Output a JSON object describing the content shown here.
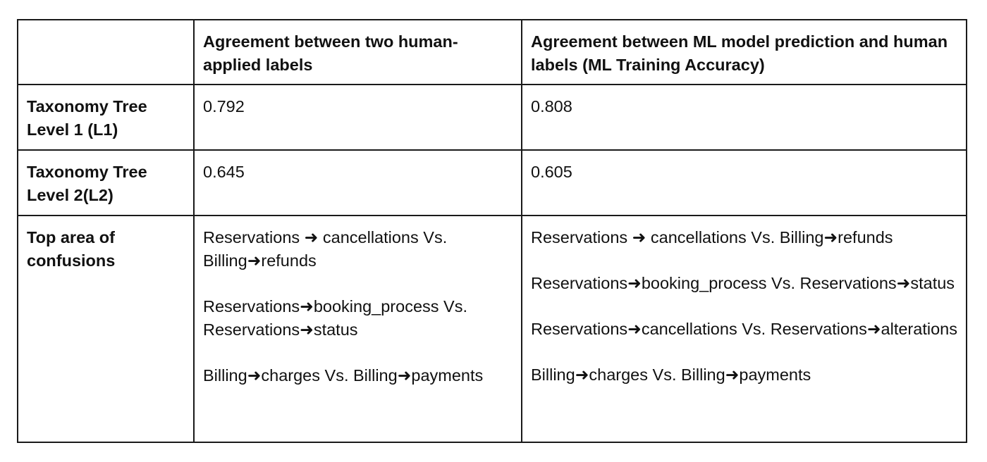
{
  "table": {
    "header": {
      "col1": "",
      "col2": "Agreement between two human-applied labels",
      "col3": "Agreement between ML model prediction and human labels (ML Training Accuracy)"
    },
    "rows": [
      {
        "label": "Taxonomy Tree Level 1 (L1)",
        "human": "0.792",
        "ml": "0.808"
      },
      {
        "label": "Taxonomy Tree Level 2(L2)",
        "human": "0.645",
        "ml": "0.605"
      }
    ],
    "confusions": {
      "label": "Top area of confusions",
      "human": [
        "Reservations ➜ cancellations Vs. Billing➜refunds",
        "Reservations➜booking_process Vs. Reservations➜status",
        "Billing➜charges Vs. Billing➜payments"
      ],
      "ml": [
        "Reservations ➜ cancellations Vs. Billing➜refunds",
        "Reservations➜booking_process Vs. Reservations➜status",
        "Reservations➜cancellations Vs. Reservations➜alterations",
        "Billing➜charges Vs. Billing➜payments"
      ]
    }
  }
}
